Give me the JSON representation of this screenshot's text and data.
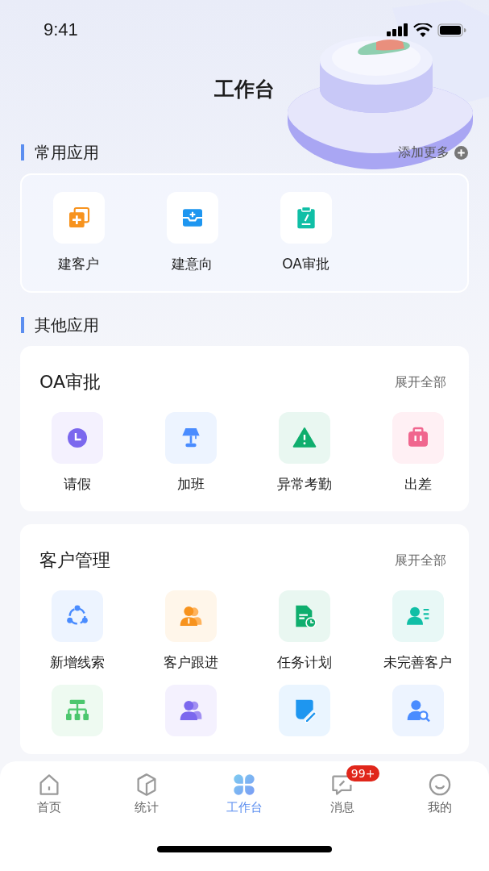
{
  "status_bar": {
    "time": "9:41"
  },
  "title": "工作台",
  "frequent": {
    "heading": "常用应用",
    "action": "添加更多",
    "apps": [
      {
        "kind": "add-copy",
        "label": "建客户"
      },
      {
        "kind": "inbox-plus",
        "label": "建意向"
      },
      {
        "kind": "clipboard",
        "label": "OA审批"
      }
    ]
  },
  "other": {
    "heading": "其他应用",
    "groups": [
      {
        "title": "OA审批",
        "action": "展开全部",
        "apps": [
          {
            "kind": "clock",
            "label": "请假"
          },
          {
            "kind": "lamp",
            "label": "加班"
          },
          {
            "kind": "warning",
            "label": "异常考勤"
          },
          {
            "kind": "suitcase",
            "label": "出差"
          }
        ]
      },
      {
        "title": "客户管理",
        "action": "展开全部",
        "apps": [
          {
            "kind": "share",
            "label": "新增线索"
          },
          {
            "kind": "users-orange",
            "label": "客户跟进"
          },
          {
            "kind": "doc-chart",
            "label": "任务计划"
          },
          {
            "kind": "user-list",
            "label": "未完善客户"
          },
          {
            "kind": "hierarchy"
          },
          {
            "kind": "users-purple"
          },
          {
            "kind": "edit"
          },
          {
            "kind": "user-search"
          }
        ]
      }
    ]
  },
  "tab_bar": [
    {
      "kind": "home",
      "label": "首页",
      "selected": false
    },
    {
      "kind": "cube",
      "label": "统计",
      "selected": false
    },
    {
      "kind": "clover",
      "label": "工作台",
      "selected": true
    },
    {
      "kind": "chat",
      "label": "消息",
      "selected": false,
      "badge": "99+"
    },
    {
      "kind": "smile",
      "label": "我的",
      "selected": false
    }
  ]
}
